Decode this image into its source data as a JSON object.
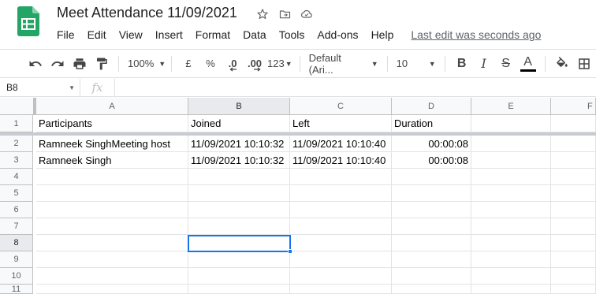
{
  "title": {
    "doc_name": "Meet Attendance 11/09/2021",
    "icons": [
      "star-icon",
      "move-to-folder-icon",
      "cloud-status-icon"
    ]
  },
  "menu": {
    "items": [
      "File",
      "Edit",
      "View",
      "Insert",
      "Format",
      "Data",
      "Tools",
      "Add-ons",
      "Help"
    ],
    "last_edit": "Last edit was seconds ago"
  },
  "toolbar": {
    "zoom": "100%",
    "currency": "£",
    "percent": "%",
    "decrease_decimal": ".0",
    "increase_decimal": ".00",
    "more_formats": "123",
    "font": "Default (Ari...",
    "font_size": "10",
    "bold": "B",
    "italic": "I",
    "strike": "S",
    "text_color": "A",
    "text_color_value": "#000000"
  },
  "formula_bar": {
    "name_box": "B8",
    "fx": "fx",
    "formula": ""
  },
  "grid": {
    "columns": [
      "A",
      "B",
      "C",
      "D",
      "E",
      "F"
    ],
    "active_column": "B",
    "active_row": "8",
    "row_numbers": [
      "1",
      "2",
      "3",
      "4",
      "5",
      "6",
      "7",
      "8",
      "9",
      "10",
      "11"
    ],
    "headers": [
      "Participants",
      "Joined",
      "Left",
      "Duration"
    ],
    "rows": [
      [
        "Ramneek SinghMeeting host",
        "11/09/2021 10:10:32",
        "11/09/2021 10:10:40",
        "00:00:08"
      ],
      [
        "Ramneek Singh",
        "11/09/2021 10:10:32",
        "11/09/2021 10:10:40",
        "00:00:08"
      ]
    ]
  },
  "colors": {
    "accent": "#1a73e8",
    "logo_green": "#23a566"
  }
}
